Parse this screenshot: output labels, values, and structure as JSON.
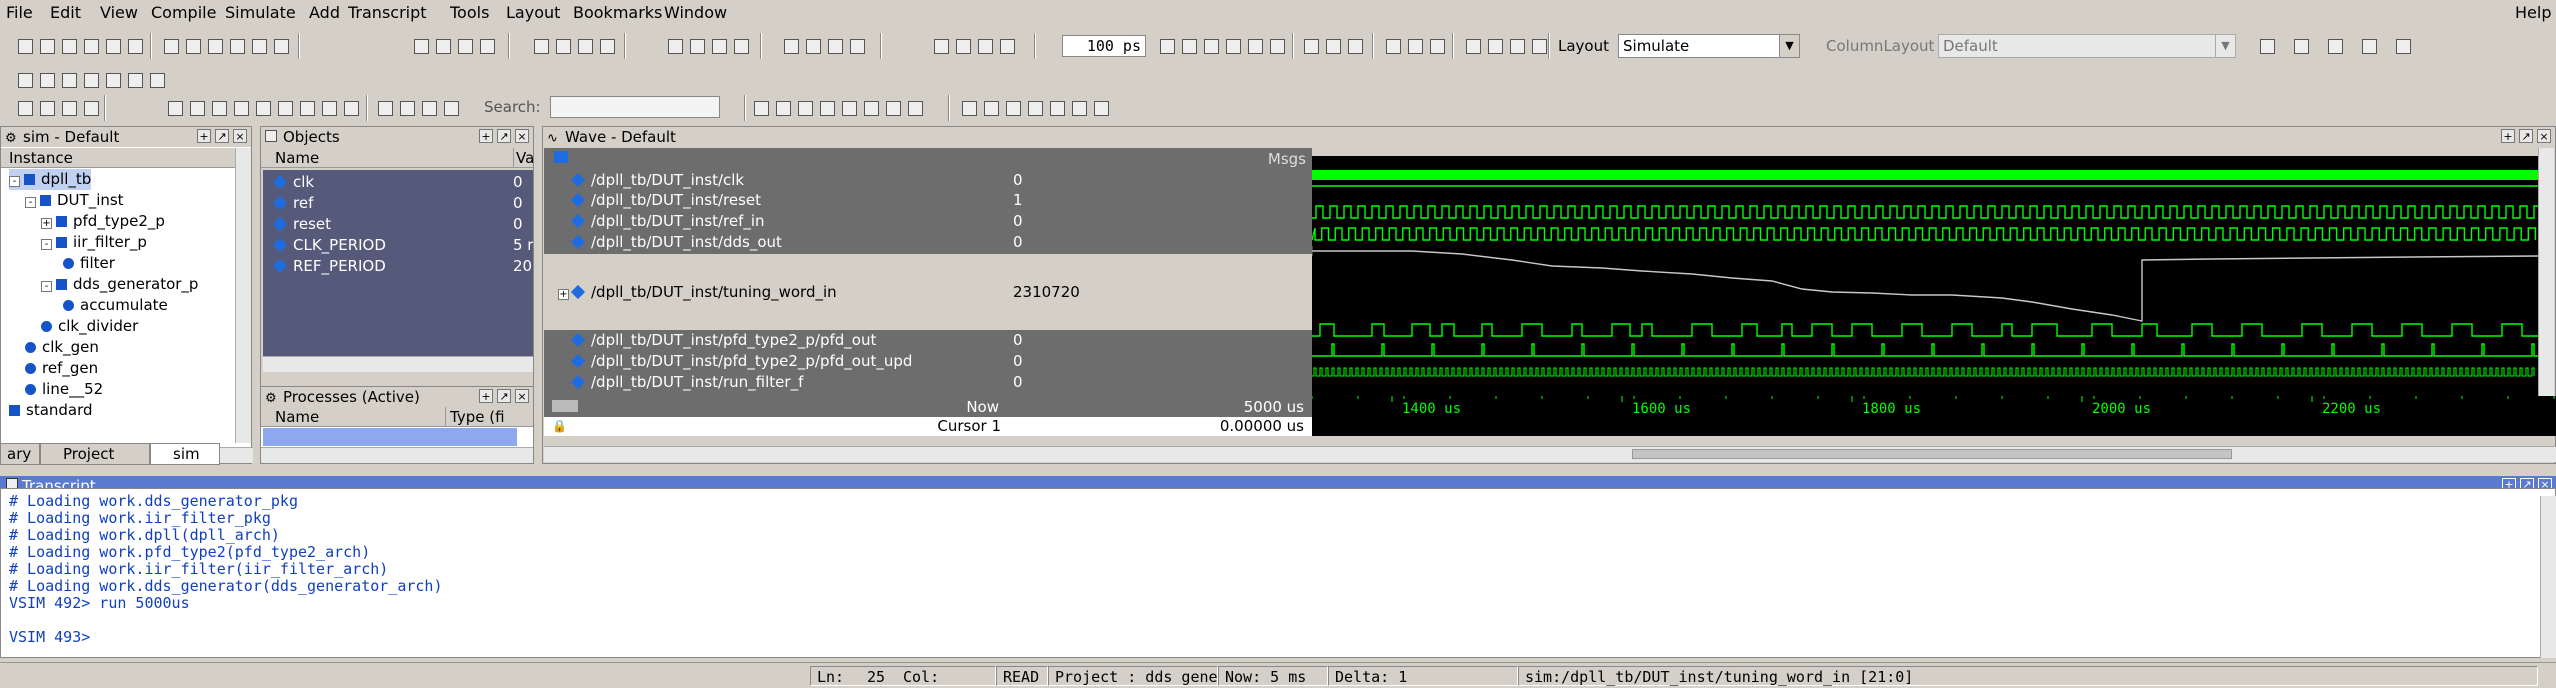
{
  "menu": [
    "File",
    "Edit",
    "View",
    "Compile",
    "Simulate",
    "Add",
    "Transcript",
    "Tools",
    "Layout",
    "Bookmarks",
    "Window"
  ],
  "help": "Help",
  "toolbar": {
    "zoom_value": "100 ps",
    "layout_label": "Layout",
    "layout_value": "Simulate",
    "column_layout_label": "ColumnLayout",
    "column_layout_value": "Default",
    "search_label": "Search:",
    "search_placeholder": ""
  },
  "sim_panel": {
    "title": "sim - Default",
    "col_instance": "Instance",
    "items": [
      {
        "label": "dpll_tb",
        "icon": "square",
        "expander": "-"
      },
      {
        "label": "DUT_inst",
        "icon": "square",
        "expander": "-"
      },
      {
        "label": "pfd_type2_p",
        "icon": "square",
        "expander": "+"
      },
      {
        "label": "iir_filter_p",
        "icon": "square",
        "expander": "-"
      },
      {
        "label": "filter",
        "icon": "dot",
        "expander": ""
      },
      {
        "label": "dds_generator_p",
        "icon": "square",
        "expander": "-"
      },
      {
        "label": "accumulate",
        "icon": "dot",
        "expander": ""
      },
      {
        "label": "clk_divider",
        "icon": "dot",
        "expander": ""
      },
      {
        "label": "clk_gen",
        "icon": "dot",
        "expander": ""
      },
      {
        "label": "ref_gen",
        "icon": "dot",
        "expander": ""
      },
      {
        "label": "line__52",
        "icon": "dot",
        "expander": ""
      },
      {
        "label": "standard",
        "icon": "square",
        "expander": ""
      }
    ],
    "tabs": [
      "ary",
      "Project",
      "sim"
    ]
  },
  "objects_panel": {
    "title": "Objects",
    "col_name": "Name",
    "col_value": "Va",
    "items": [
      {
        "name": "clk",
        "value": "0"
      },
      {
        "name": "ref",
        "value": "0"
      },
      {
        "name": "reset",
        "value": "0"
      },
      {
        "name": "CLK_PERIOD",
        "value": "5 r"
      },
      {
        "name": "REF_PERIOD",
        "value": "20"
      }
    ]
  },
  "processes_panel": {
    "title": "Processes (Active)",
    "col_name": "Name",
    "col_type": "Type (fi"
  },
  "wave_panel": {
    "title": "Wave - Default",
    "msgs_label": "Msgs",
    "signals": [
      {
        "name": "/dpll_tb/DUT_inst/clk",
        "value": "0"
      },
      {
        "name": "/dpll_tb/DUT_inst/reset",
        "value": "1"
      },
      {
        "name": "/dpll_tb/DUT_inst/ref_in",
        "value": "0"
      },
      {
        "name": "/dpll_tb/DUT_inst/dds_out",
        "value": "0"
      },
      {
        "name": "/dpll_tb/DUT_inst/tuning_word_in",
        "value": "2310720"
      },
      {
        "name": "/dpll_tb/DUT_inst/pfd_type2_p/pfd_out",
        "value": "0"
      },
      {
        "name": "/dpll_tb/DUT_inst/pfd_type2_p/pfd_out_upd",
        "value": "0"
      },
      {
        "name": "/dpll_tb/DUT_inst/run_filter_f",
        "value": "0"
      }
    ],
    "now_label": "Now",
    "now_value": "5000 us",
    "cursor_label": "Cursor 1",
    "cursor_value": "0.00000 us",
    "time_ticks": [
      "1400 us",
      "1600 us",
      "1800 us",
      "2000 us",
      "2200 us"
    ],
    "colors": {
      "wave": "#00ff00",
      "analog": "#c8c8c8",
      "bg": "#000000"
    }
  },
  "transcript": {
    "title": "Transcript",
    "lines": [
      "# Loading work.dds_generator_pkg",
      "# Loading work.iir_filter_pkg",
      "# Loading work.dpll(dpll_arch)",
      "# Loading work.pfd_type2(pfd_type2_arch)",
      "# Loading work.iir_filter(iir_filter_arch)",
      "# Loading work.dds_generator(dds_generator_arch)"
    ],
    "cmd1": "VSIM 492> run 5000us",
    "cmd2": "VSIM 493>"
  },
  "status": {
    "ln_label": "Ln:",
    "ln_value": "25",
    "col_label": "Col:",
    "mode": "READ",
    "project": "Project : dds_generator",
    "now": "Now: 5 ms",
    "delta": "Delta: 1",
    "path": "sim:/dpll_tb/DUT_inst/tuning_word_in [21:0]"
  }
}
